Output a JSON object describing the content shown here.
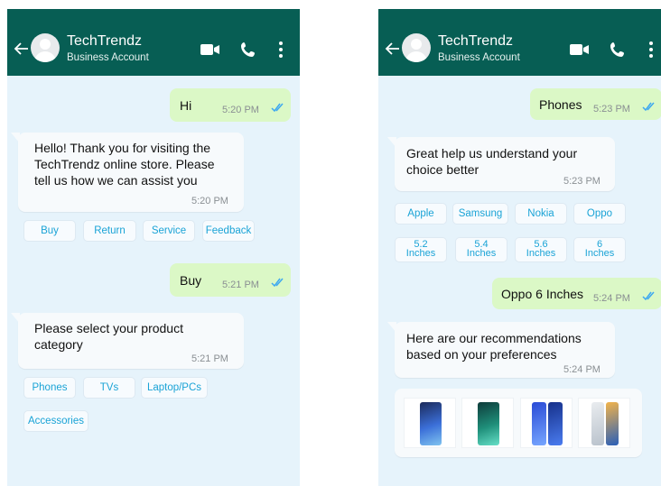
{
  "colors": {
    "header": "#075e54",
    "chat_bg": "#e6f3fb",
    "outgoing": "#dbf8c6",
    "incoming": "#f7fafc",
    "chip_text": "#1aa3d6",
    "tick": "#3ea8f0"
  },
  "left": {
    "header": {
      "title": "TechTrendz",
      "subtitle": "Business Account"
    },
    "msg_hi": {
      "text": "Hi",
      "time": "5:20 PM"
    },
    "msg_welcome": {
      "text": "Hello! Thank you for visiting the TechTrendz online store. Please tell us how we can assist you",
      "time": "5:20 PM"
    },
    "chips_1": [
      "Buy",
      "Return",
      "Service",
      "Feedback"
    ],
    "msg_buy": {
      "text": "Buy",
      "time": "5:21 PM"
    },
    "msg_category": {
      "text": "Please select your product category",
      "time": "5:21 PM"
    },
    "chips_2": [
      "Phones",
      "TVs",
      "Laptop/PCs",
      "Accessories"
    ]
  },
  "right": {
    "header": {
      "title": "TechTrendz",
      "subtitle": "Business Account"
    },
    "msg_phones": {
      "text": "Phones",
      "time": "5:23 PM"
    },
    "msg_help": {
      "text": "Great help us understand your choice better",
      "time": "5:23 PM"
    },
    "brand_chips": [
      "Apple",
      "Samsung",
      "Nokia",
      "Oppo"
    ],
    "size_chips": [
      {
        "l1": "5.2",
        "l2": "Inches"
      },
      {
        "l1": "5.4",
        "l2": "Inches"
      },
      {
        "l1": "5.6",
        "l2": "Inches"
      },
      {
        "l1": "6",
        "l2": "Inches"
      }
    ],
    "msg_oppo": {
      "text": "Oppo 6 Inches",
      "time": "5:24 PM"
    },
    "msg_reco": {
      "text": "Here are our recommendations based on your preferences",
      "time": "5:24 PM"
    },
    "products": [
      "phone-1",
      "phone-2",
      "phone-3",
      "phone-4"
    ]
  },
  "icons": {
    "back": "arrow-left-icon",
    "video": "video-camera-icon",
    "call": "phone-icon",
    "more": "more-vertical-icon",
    "read": "double-check-icon"
  }
}
